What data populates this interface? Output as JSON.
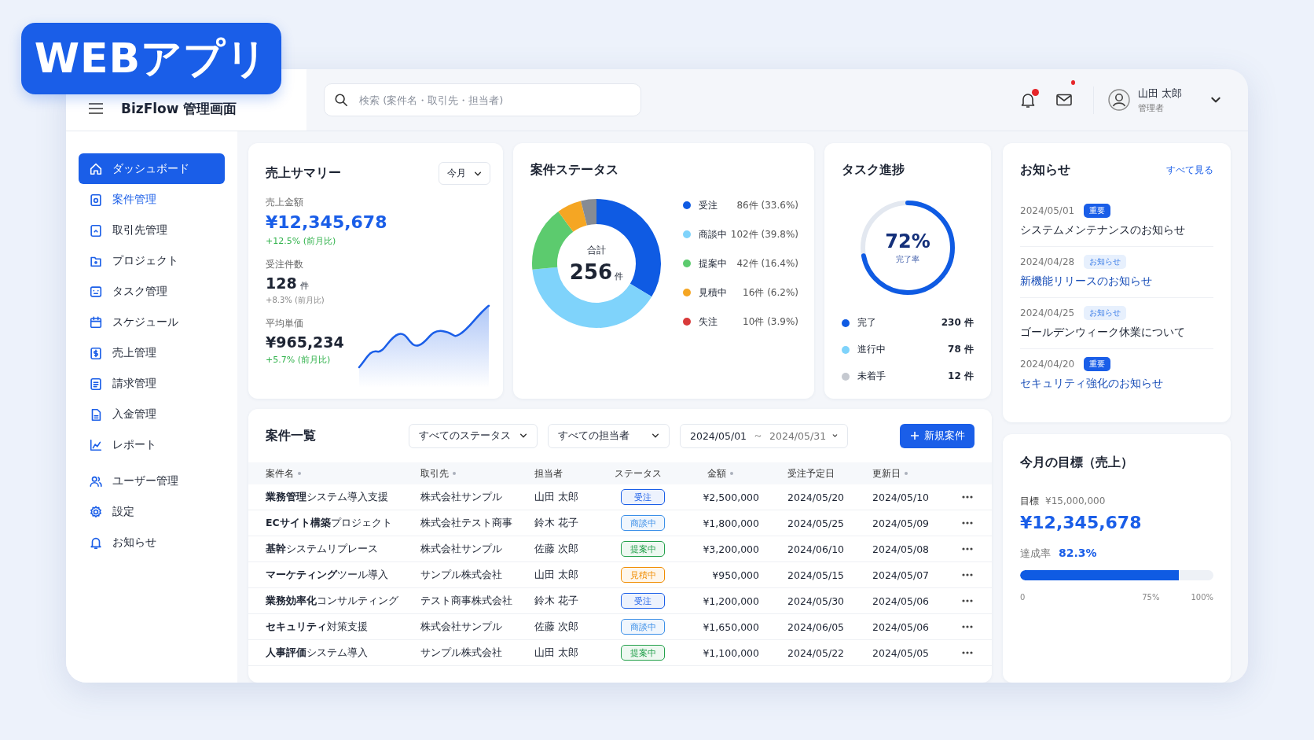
{
  "badge": {
    "label": "WEBアプリ"
  },
  "header": {
    "app_title": "BizFlow 管理画面",
    "search": {
      "placeholder": "検索 (案件名・取引先・担当者)"
    },
    "notifications": {
      "unread": true
    },
    "mail": {
      "unread": true
    },
    "user": {
      "name": "山田 太郎",
      "role": "管理者"
    }
  },
  "sidebar": {
    "sections": [
      {
        "items": [
          {
            "label": "ダッシュボード",
            "selected": true,
            "highlighted": false
          },
          {
            "label": "案件管理",
            "selected": false,
            "highlighted": true
          },
          {
            "label": "取引先管理",
            "selected": false,
            "highlighted": false
          },
          {
            "label": "プロジェクト",
            "selected": false,
            "highlighted": false
          },
          {
            "label": "タスク管理",
            "selected": false,
            "highlighted": false
          },
          {
            "label": "スケジュール",
            "selected": false,
            "highlighted": false
          },
          {
            "label": "売上管理",
            "selected": false,
            "highlighted": false
          },
          {
            "label": "請求管理",
            "selected": false,
            "highlighted": false
          },
          {
            "label": "入金管理",
            "selected": false,
            "highlighted": false
          },
          {
            "label": "レポート",
            "selected": false,
            "highlighted": false
          }
        ]
      },
      {
        "items": [
          {
            "label": "ユーザー管理",
            "selected": false,
            "highlighted": false
          },
          {
            "label": "設定",
            "selected": false,
            "highlighted": false
          },
          {
            "label": "お知らせ",
            "selected": false,
            "highlighted": false
          }
        ]
      }
    ]
  },
  "sales_summary": {
    "title": "売上サマリー",
    "period": "今月",
    "metrics": [
      {
        "label": "売上金額",
        "value": "¥12,345,678",
        "change": "+12.5% (前月比)",
        "positive": true,
        "emphasis": true
      },
      {
        "label": "受注件数",
        "value": "128",
        "unit": "件",
        "change": "+8.3% (前月比)",
        "positive": false,
        "emphasis": false
      },
      {
        "label": "平均単価",
        "value": "¥965,234",
        "change": "+5.7% (前月比)",
        "positive": true,
        "emphasis": false
      }
    ]
  },
  "deal_status": {
    "title": "案件ステータス",
    "center_label": "合計",
    "center_value": "256",
    "center_unit": "件",
    "chart_data": {
      "type": "donut",
      "categories": [
        "受注",
        "商談中",
        "提案中",
        "見積中",
        "失注"
      ],
      "values": [
        33.6,
        39.8,
        16.4,
        6.2,
        3.9
      ],
      "colors": [
        "#0f5be3",
        "#7fd3fb",
        "#5ccb6e",
        "#f5a623",
        "#868b94"
      ]
    },
    "legend": [
      {
        "value": "86件 (33.6%)",
        "color": "#0f5be3"
      },
      {
        "value": "102件 (39.8%)",
        "color": "#7fd3fb"
      },
      {
        "value": "42件 (16.4%)",
        "color": "#5ccb6e"
      },
      {
        "value": "16件 (6.2%)",
        "color": "#f5a623"
      },
      {
        "value": "10件 (3.9%)",
        "color": "#d93a3a"
      }
    ]
  },
  "task_progress": {
    "title": "タスク進捗",
    "percent": "72%",
    "caption": "完了率",
    "legend": [
      {
        "label": "完了",
        "value": "230 件",
        "color": "#0f5be3"
      },
      {
        "label": "進行中",
        "value": "78 件",
        "color": "#7fd3fb"
      },
      {
        "label": "未着手",
        "value": "12 件",
        "color": "#c5c9d0"
      }
    ]
  },
  "news": {
    "title": "お知らせ",
    "more": "すべて見る",
    "items": [
      {
        "date": "2024/05/01",
        "tag": {
          "label": "重要",
          "kind": "important"
        },
        "title": "システムメンテナンスのお知らせ",
        "highlighted": false
      },
      {
        "date": "2024/04/28",
        "tag": {
          "label": "お知らせ",
          "kind": "info"
        },
        "title": "新機能リリースのお知らせ",
        "highlighted": true
      },
      {
        "date": "2024/04/25",
        "tag": {
          "label": "お知らせ",
          "kind": "info"
        },
        "title": "ゴールデンウィーク休業について",
        "highlighted": false
      },
      {
        "date": "2024/04/20",
        "tag": {
          "label": "重要",
          "kind": "important"
        },
        "title": "セキュリティ強化のお知らせ",
        "highlighted": true
      }
    ]
  },
  "deals": {
    "title": "案件一覧",
    "filters": [
      {
        "label": "すべてのステータス"
      },
      {
        "label": "すべての担当者"
      }
    ],
    "date_range": {
      "start": "2024/05/01",
      "separator": "～",
      "end": "2024/05/31"
    },
    "new_button": "新規案件",
    "columns": [
      {
        "label": "案件名",
        "sortable": true
      },
      {
        "label": "取引先",
        "sortable": true
      },
      {
        "label": "担当者",
        "sortable": false
      },
      {
        "label": "ステータス",
        "sortable": false
      },
      {
        "label": "金額",
        "sortable": true
      },
      {
        "label": "受注予定日",
        "sortable": false
      },
      {
        "label": "更新日",
        "sortable": true
      }
    ],
    "rows": [
      {
        "name": "**業務管理**システム導入支援",
        "client": "株式会社サンプル",
        "owner": "山田 太郎",
        "status": {
          "label": "受注",
          "color": "#1a5ee8"
        },
        "amount": "¥2,500,000",
        "due": "2024/05/20",
        "updated": "2024/05/10"
      },
      {
        "name": "**ECサイト構築**プロジェクト",
        "client": "株式会社テスト商事",
        "owner": "鈴木 花子",
        "status": {
          "label": "商談中",
          "color": "#3b8fe8"
        },
        "amount": "¥1,800,000",
        "due": "2024/05/25",
        "updated": "2024/05/09"
      },
      {
        "name": "**基幹**システムリプレース",
        "client": "株式会社サンプル",
        "owner": "佐藤 次郎",
        "status": {
          "label": "提案中",
          "color": "#22a04a"
        },
        "amount": "¥3,200,000",
        "due": "2024/06/10",
        "updated": "2024/05/08"
      },
      {
        "name": "**マーケティング**ツール導入",
        "client": "サンプル株式会社",
        "owner": "山田 太郎",
        "status": {
          "label": "見積中",
          "color": "#f08c00"
        },
        "amount": "¥950,000",
        "due": "2024/05/15",
        "updated": "2024/05/07"
      },
      {
        "name": "**業務効率化**コンサルティング",
        "client": "テスト商事株式会社",
        "owner": "鈴木 花子",
        "status": {
          "label": "受注",
          "color": "#1a5ee8"
        },
        "amount": "¥1,200,000",
        "due": "2024/05/30",
        "updated": "2024/05/06"
      },
      {
        "name": "**セキュリティ**対策支援",
        "client": "株式会社サンプル",
        "owner": "佐藤 次郎",
        "status": {
          "label": "商談中",
          "color": "#3b8fe8"
        },
        "amount": "¥1,650,000",
        "due": "2024/06/05",
        "updated": "2024/05/06"
      },
      {
        "name": "**人事評価**システム導入",
        "client": "サンプル株式会社",
        "owner": "山田 太郎",
        "status": {
          "label": "提案中",
          "color": "#22a04a"
        },
        "amount": "¥1,100,000",
        "due": "2024/05/22",
        "updated": "2024/05/05"
      }
    ]
  },
  "goal": {
    "title": "今月の目標（売上）",
    "target_label": "目標",
    "target_value": "¥15,000,000",
    "value": "¥12,345,678",
    "rate_label": "達成率",
    "rate": "82.3%",
    "level": 0.823,
    "scale": [
      "0",
      "75%",
      "100%"
    ]
  }
}
